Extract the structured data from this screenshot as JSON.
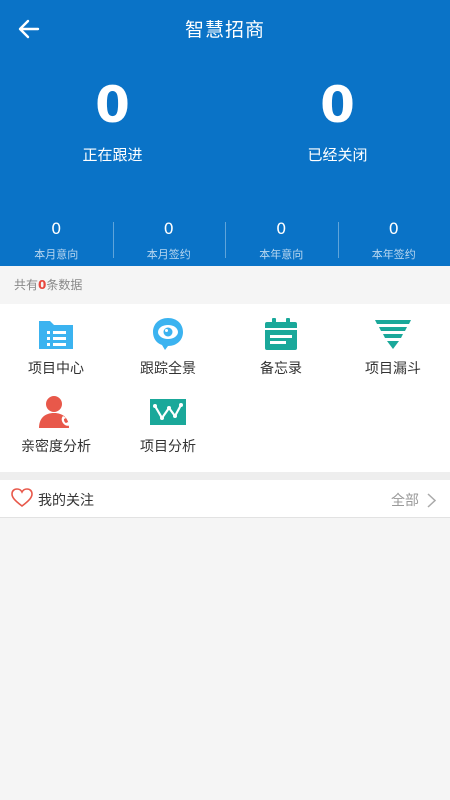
{
  "header": {
    "title": "智慧招商",
    "back_icon": "back-arrow-icon"
  },
  "big_stats": [
    {
      "value": "0",
      "label": "正在跟进"
    },
    {
      "value": "0",
      "label": "已经关闭"
    }
  ],
  "small_stats": [
    {
      "value": "0",
      "label": "本月意向"
    },
    {
      "value": "0",
      "label": "本月签约"
    },
    {
      "value": "0",
      "label": "本年意向"
    },
    {
      "value": "0",
      "label": "本年签约"
    }
  ],
  "count_bar": {
    "prefix": "共有",
    "count": "0",
    "suffix": "条数据"
  },
  "grid": [
    {
      "label": "项目中心",
      "icon": "folder-list-icon",
      "color": "#3bb3f0"
    },
    {
      "label": "跟踪全景",
      "icon": "eye-icon",
      "color": "#3bb3f0"
    },
    {
      "label": "备忘录",
      "icon": "calendar-icon",
      "color": "#1aa89a"
    },
    {
      "label": "项目漏斗",
      "icon": "funnel-icon",
      "color": "#1aa89a"
    },
    {
      "label": "亲密度分析",
      "icon": "user-phone-icon",
      "color": "#e8584a"
    },
    {
      "label": "项目分析",
      "icon": "line-chart-icon",
      "color": "#1aa89a"
    }
  ],
  "follow": {
    "title": "我的关注",
    "all_label": "全部"
  },
  "colors": {
    "header_bg": "#0a73c7",
    "accent_red": "#e8473e"
  }
}
